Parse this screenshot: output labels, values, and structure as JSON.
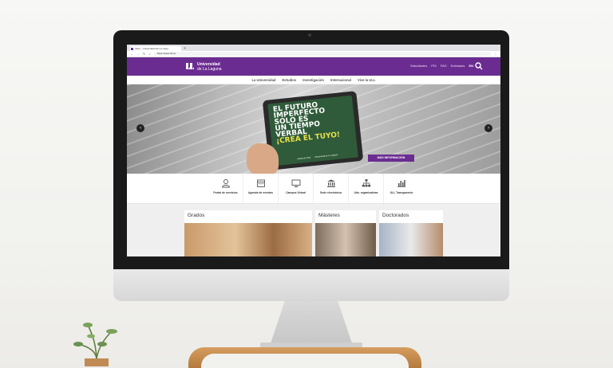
{
  "browser": {
    "tab_title": "Inicio - Universidad de La Lagu...",
    "new_tab": "+",
    "url": "https://www.ull.es"
  },
  "site": {
    "brand_color": "#6b2c91",
    "logo_line1": "Universidad",
    "logo_line2": "de La Laguna",
    "header_links": [
      "Estudiantes",
      "PDI",
      "PAS",
      "Entidades"
    ],
    "lang": "EN"
  },
  "nav": {
    "items": [
      "La Universidad",
      "Estudios",
      "Investigación",
      "Internacional",
      "Vive la ULL"
    ]
  },
  "hero": {
    "slogan": [
      "EL FUTURO",
      "IMPERFECTO",
      "SOLO ES",
      "UN TIEMPO",
      "VERBAL"
    ],
    "cta_slogan": "¡CREA EL TUYO!",
    "tablet_badge": "Matrícula 2018",
    "tablet_logo": "Universidad de La Laguna",
    "button": "MÁS INFORMACIÓN"
  },
  "quicklinks": [
    {
      "label": "Portal de servicios",
      "icon": "user-icon"
    },
    {
      "label": "Agenda de eventos",
      "icon": "calendar-icon"
    },
    {
      "label": "Campus Virtual",
      "icon": "monitor-icon"
    },
    {
      "label": "Sede electrónica",
      "icon": "building-icon"
    },
    {
      "label": "Uds. organizativas",
      "icon": "org-chart-icon"
    },
    {
      "label": "ULL Transparente",
      "icon": "bar-chart-icon"
    }
  ],
  "cards": {
    "grados": "Grados",
    "masteres": "Másteres",
    "doctorados": "Doctorados"
  }
}
